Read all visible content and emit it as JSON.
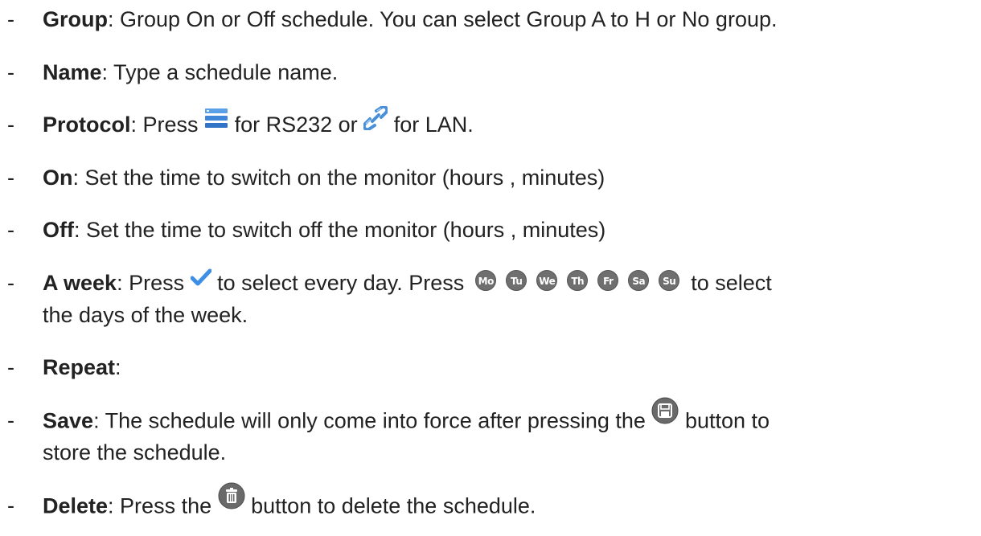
{
  "items": [
    {
      "term": "Group",
      "desc": ": Group On or Off schedule. You can select Group A to H or No group."
    },
    {
      "term": "Name",
      "desc": ": Type a schedule name."
    },
    {
      "term": "Protocol",
      "desc_a": ": Press",
      "desc_b": "for RS232 or",
      "desc_c": "for LAN."
    },
    {
      "term": "On",
      "desc": ": Set the time to switch on the monitor (hours , minutes)"
    },
    {
      "term": "Off",
      "desc": ": Set the time to switch off the monitor (hours , minutes)"
    },
    {
      "term": "A week",
      "desc_a": ": Press",
      "desc_b": "to select every day. Press",
      "desc_c": "to select",
      "desc_line2": "the days of the week.",
      "days": [
        "Mo",
        "Tu",
        "We",
        "Th",
        "Fr",
        "Sa",
        "Su"
      ]
    },
    {
      "term": "Repeat",
      "desc": ":"
    },
    {
      "term": "Save",
      "desc_a": ": The schedule will only come into force after pressing the",
      "desc_b": "button to",
      "desc_line2": "store the schedule."
    },
    {
      "term": "Delete",
      "desc_a": ": Press the",
      "desc_b": "button to delete the schedule."
    }
  ],
  "dash": "-",
  "icons": {
    "rs232": "list-bars-icon",
    "lan": "chain-link-icon",
    "all_days": "checkmark-icon",
    "save": "floppy-disk-icon",
    "delete": "trash-can-icon"
  },
  "colors": {
    "text": "#222222",
    "rs232_icon": "#3f86d8",
    "lan_icon": "#4a90d9",
    "check_icon": "#3d8ee6",
    "day_icon": "#6f6f6f"
  }
}
